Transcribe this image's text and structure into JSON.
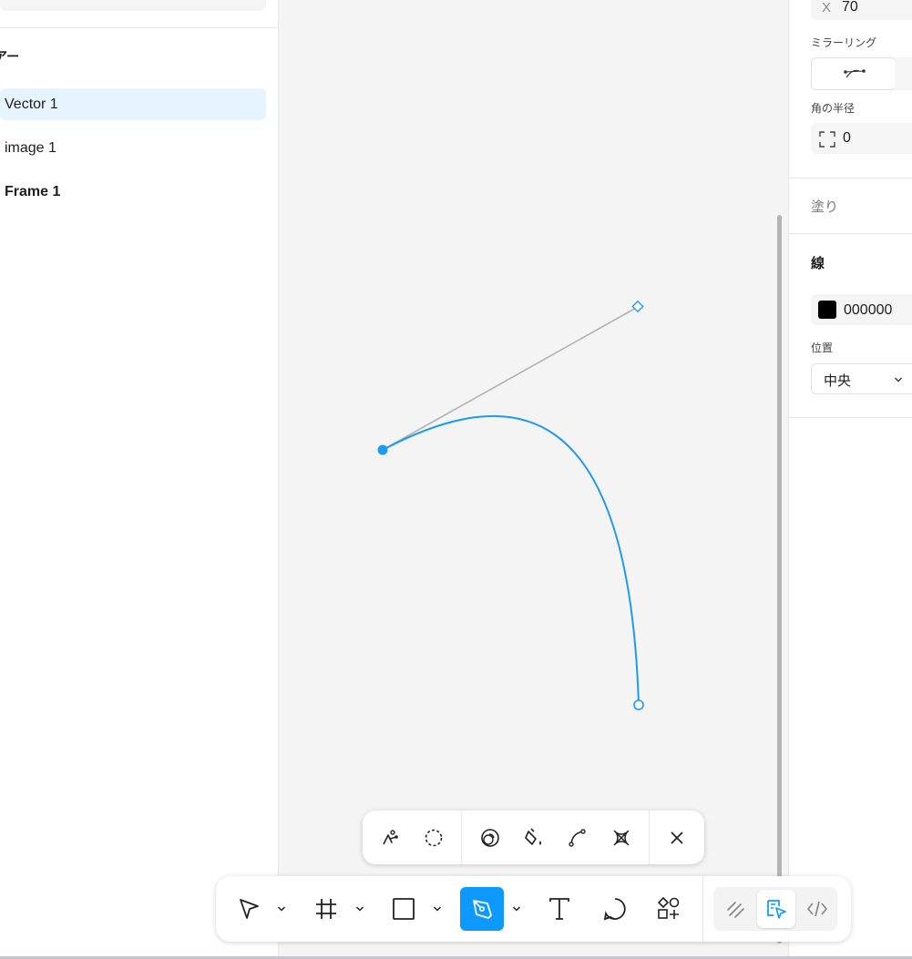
{
  "layers": {
    "title": "アー",
    "items": [
      {
        "label": "Vector 1",
        "selected": true
      },
      {
        "label": "image 1",
        "selected": false
      },
      {
        "label": "Frame 1",
        "selected": false
      }
    ]
  },
  "properties": {
    "x_label": "X",
    "x_value": "70",
    "mirroring_label": "ミラーリング",
    "corner_radius_label": "角の半径",
    "corner_radius_value": "0",
    "fill_label": "塗り",
    "stroke_label": "線",
    "stroke_color_hex": "000000",
    "position_label": "位置",
    "position_value": "中央"
  },
  "vector_tools": [
    "bend-tool-icon",
    "lasso-icon",
    "shape-builder-icon",
    "paint-bucket-icon",
    "curve-icon",
    "cut-icon",
    "close-icon"
  ],
  "main_tools": [
    "move-icon",
    "frame-icon",
    "rectangle-icon",
    "pen-icon",
    "text-icon",
    "comment-icon",
    "components-icon",
    "draw-icon",
    "design-mode-icon",
    "dev-mode-icon"
  ],
  "colors": {
    "accent": "#0d99ff",
    "selected_row": "#e5f4ff",
    "path": "#1e9bf0"
  }
}
